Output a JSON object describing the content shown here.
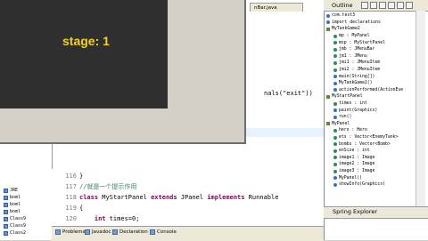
{
  "editor": {
    "tab_label": "nBar.java",
    "snippet_text": "nals(\"exit\"))",
    "code_lines": [
      {
        "num": "116",
        "parts": [
          {
            "t": "}",
            "c": ""
          }
        ]
      },
      {
        "num": "117",
        "parts": [
          {
            "t": "//就是一个提示作用",
            "c": "cm"
          }
        ]
      },
      {
        "num": "118",
        "parts": [
          {
            "t": "class ",
            "c": "kw"
          },
          {
            "t": "MyStartPanel ",
            "c": ""
          },
          {
            "t": "extends ",
            "c": "kw"
          },
          {
            "t": "JPanel ",
            "c": ""
          },
          {
            "t": "implements ",
            "c": "kw"
          },
          {
            "t": "Runnable",
            "c": ""
          }
        ]
      },
      {
        "num": "119",
        "parts": [
          {
            "t": "{",
            "c": ""
          }
        ]
      },
      {
        "num": "120",
        "parts": [
          {
            "t": "    ",
            "c": ""
          },
          {
            "t": "int ",
            "c": "kw"
          },
          {
            "t": "times=0;",
            "c": ""
          }
        ]
      }
    ]
  },
  "left_tree": [
    {
      "label": "JRE"
    },
    {
      "label": "boml"
    },
    {
      "label": "boml"
    },
    {
      "label": "boml"
    },
    {
      "label": "Class9"
    },
    {
      "label": "Class9"
    },
    {
      "label": "Class2"
    }
  ],
  "app": {
    "stage_text": "stage: 1"
  },
  "outline": {
    "title": "Outline",
    "items": [
      {
        "label": "com.test3",
        "indent": 0,
        "kind": "pkg"
      },
      {
        "label": "import declarations",
        "indent": 0,
        "kind": "pkg"
      },
      {
        "label": "MyTankGame2",
        "indent": 0,
        "kind": "cls"
      },
      {
        "label": "mp : MyPanel",
        "indent": 1,
        "kind": "field"
      },
      {
        "label": "msp : MyStartPanel",
        "indent": 1,
        "kind": "field"
      },
      {
        "label": "jmb : JMenuBar",
        "indent": 1,
        "kind": "field"
      },
      {
        "label": "jm1 : JMenu",
        "indent": 1,
        "kind": "field"
      },
      {
        "label": "jmi1 : JMenuItem",
        "indent": 1,
        "kind": "field"
      },
      {
        "label": "jmi2 : JMenuItem",
        "indent": 1,
        "kind": "field"
      },
      {
        "label": "main(String[])",
        "indent": 1,
        "kind": "method"
      },
      {
        "label": "MyTankGame2()",
        "indent": 1,
        "kind": "method"
      },
      {
        "label": "actionPerformed(ActionEve",
        "indent": 1,
        "kind": "method"
      },
      {
        "label": "MyStartPanel",
        "indent": 0,
        "kind": "cls"
      },
      {
        "label": "times : int",
        "indent": 1,
        "kind": "field"
      },
      {
        "label": "paint(Graphics)",
        "indent": 1,
        "kind": "method"
      },
      {
        "label": "run()",
        "indent": 1,
        "kind": "method"
      },
      {
        "label": "MyPanel",
        "indent": 0,
        "kind": "cls"
      },
      {
        "label": "hero : Hero",
        "indent": 1,
        "kind": "field"
      },
      {
        "label": "ets : Vector<EnemyTank>",
        "indent": 1,
        "kind": "field"
      },
      {
        "label": "bombs : Vector<Bomb>",
        "indent": 1,
        "kind": "field"
      },
      {
        "label": "enSize : int",
        "indent": 1,
        "kind": "field"
      },
      {
        "label": "image1 : Image",
        "indent": 1,
        "kind": "field"
      },
      {
        "label": "image2 : Image",
        "indent": 1,
        "kind": "field"
      },
      {
        "label": "image3 : Image",
        "indent": 1,
        "kind": "field"
      },
      {
        "label": "MyPanel()",
        "indent": 1,
        "kind": "method"
      },
      {
        "label": "showInfo(Graphics)",
        "indent": 1,
        "kind": "method"
      }
    ]
  },
  "spring": {
    "title": "Spring Explorer"
  },
  "bottom_tabs": [
    {
      "label": "Problems"
    },
    {
      "label": "Javadoc"
    },
    {
      "label": "Declaration"
    },
    {
      "label": "Console"
    }
  ]
}
